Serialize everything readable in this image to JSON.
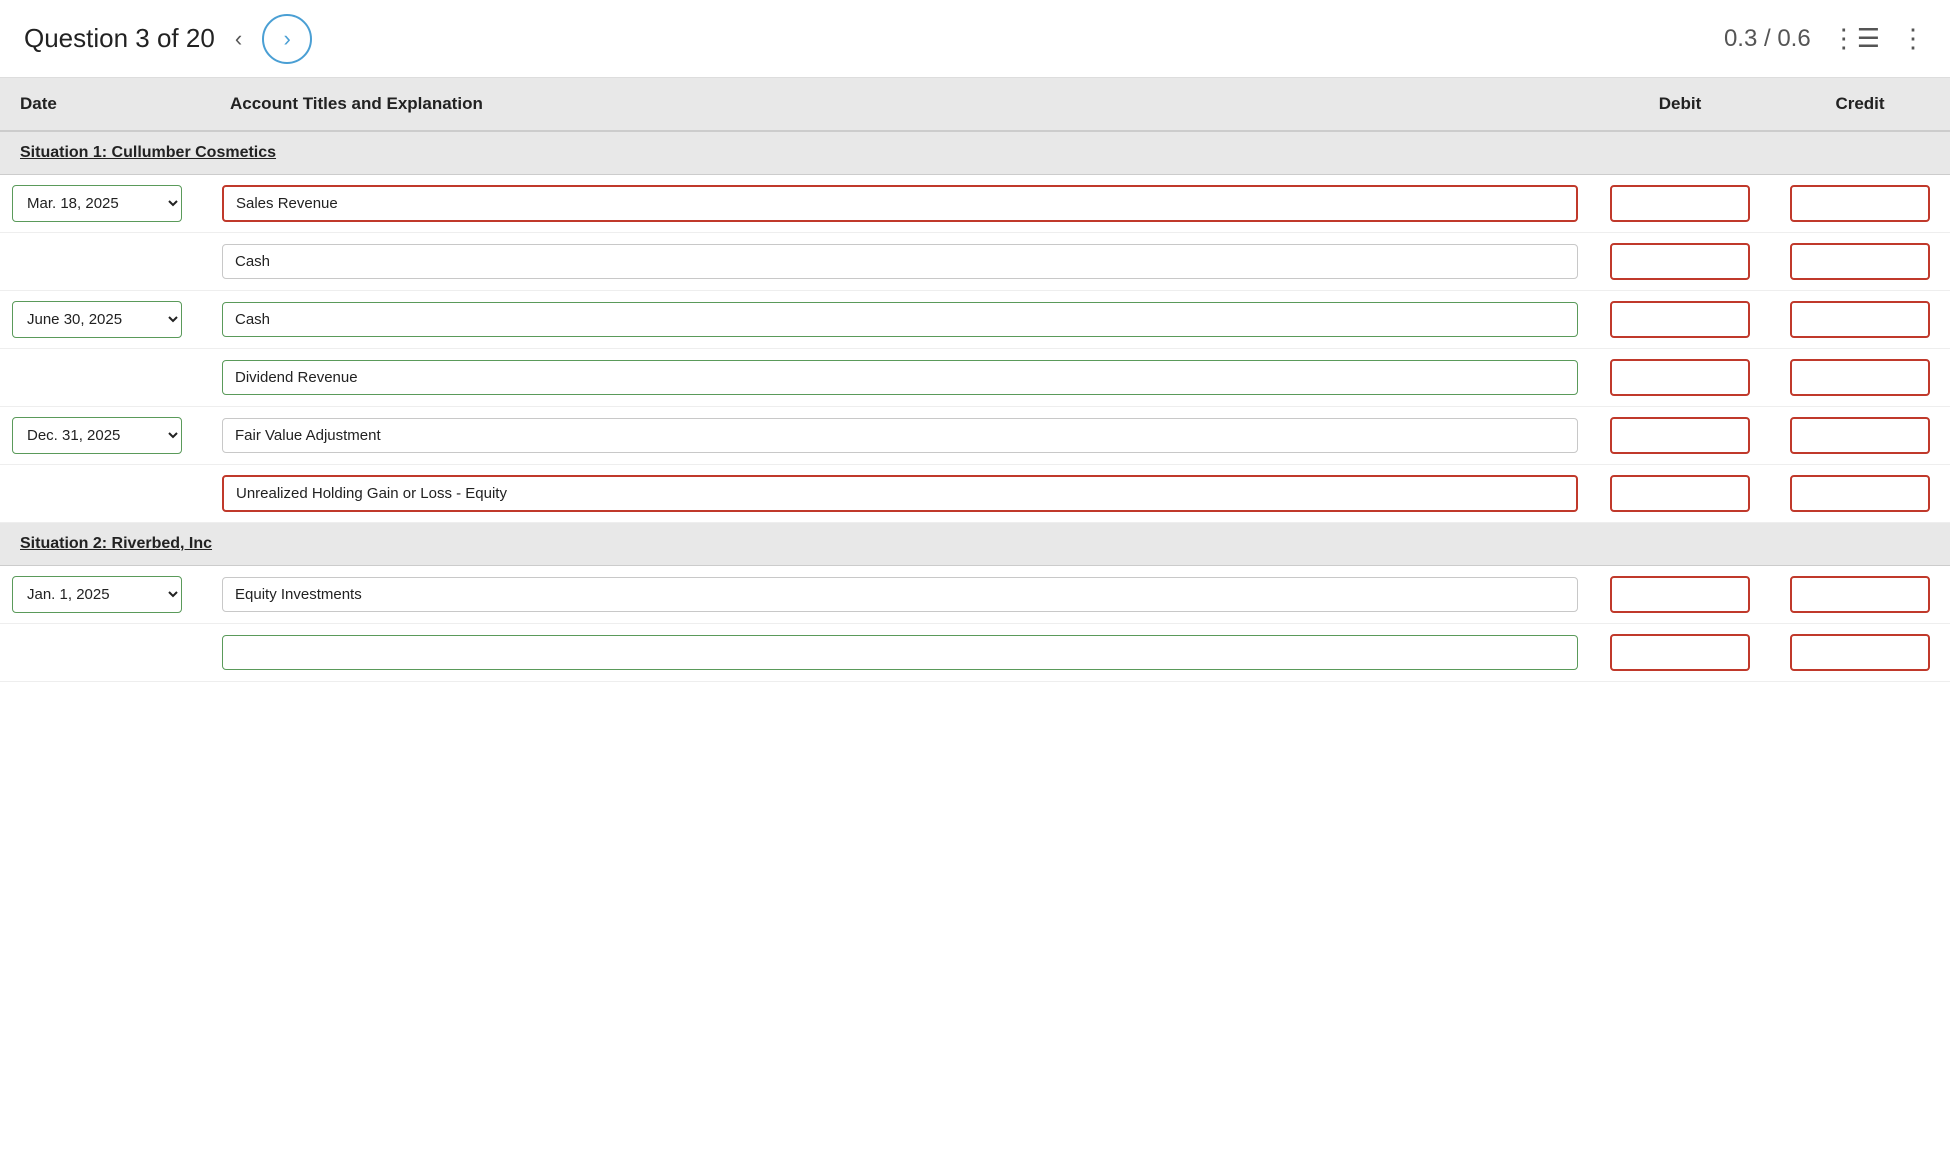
{
  "header": {
    "question_label": "Question 3 of 20",
    "prev_arrow": "‹",
    "next_arrow": "›",
    "score": "0.3 / 0.6"
  },
  "table": {
    "columns": [
      "Date",
      "Account Titles and Explanation",
      "Debit",
      "Credit"
    ],
    "situation1": {
      "label": "Situation 1: Cullumber Cosmetics",
      "rows": [
        {
          "date": "Mar. 18, 2025",
          "account": "Sales Revenue",
          "account_border": "red",
          "debit": "",
          "credit": ""
        },
        {
          "date": "",
          "account": "Cash",
          "account_border": "gray",
          "debit": "",
          "credit": ""
        },
        {
          "date": "June 30, 2025",
          "account": "Cash",
          "account_border": "green",
          "debit": "",
          "credit": ""
        },
        {
          "date": "",
          "account": "Dividend Revenue",
          "account_border": "green",
          "debit": "",
          "credit": ""
        },
        {
          "date": "Dec. 31, 2025",
          "account": "Fair Value Adjustment",
          "account_border": "gray",
          "debit": "",
          "credit": ""
        },
        {
          "date": "",
          "account": "Unrealized Holding Gain or Loss - Equity",
          "account_border": "red",
          "debit": "",
          "credit": ""
        }
      ]
    },
    "situation2": {
      "label": "Situation 2: Riverbed, Inc",
      "rows": [
        {
          "date": "Jan. 1, 2025",
          "account": "Equity Investments",
          "account_border": "gray",
          "debit": "",
          "credit": ""
        },
        {
          "date": "",
          "account": "",
          "account_border": "green",
          "debit": "",
          "credit": ""
        }
      ]
    }
  }
}
